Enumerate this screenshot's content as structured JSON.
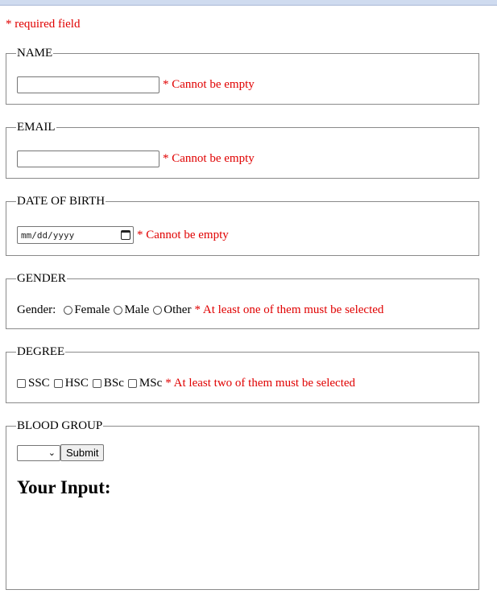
{
  "required_note": "* required field",
  "name_section": {
    "legend": "NAME",
    "value": "",
    "error": "* Cannot be empty"
  },
  "email_section": {
    "legend": "EMAIL",
    "value": "",
    "error": "* Cannot be empty"
  },
  "dob_section": {
    "legend": "DATE OF BIRTH",
    "placeholder": "mm/dd/yyyy",
    "error": "* Cannot be empty"
  },
  "gender_section": {
    "legend": "GENDER",
    "label": "Gender:",
    "options": [
      "Female",
      "Male",
      "Other"
    ],
    "error": "* At least one of them must be selected"
  },
  "degree_section": {
    "legend": "DEGREE",
    "options": [
      "SSC",
      "HSC",
      "BSc",
      "MSc"
    ],
    "error": "* At least two of them must be selected"
  },
  "blood_section": {
    "legend": "BLOOD GROUP",
    "selected": "",
    "submit_label": "Submit",
    "output_heading": "Your Input:"
  },
  "colors": {
    "error": "#e00000",
    "border": "#8a8a8a"
  }
}
